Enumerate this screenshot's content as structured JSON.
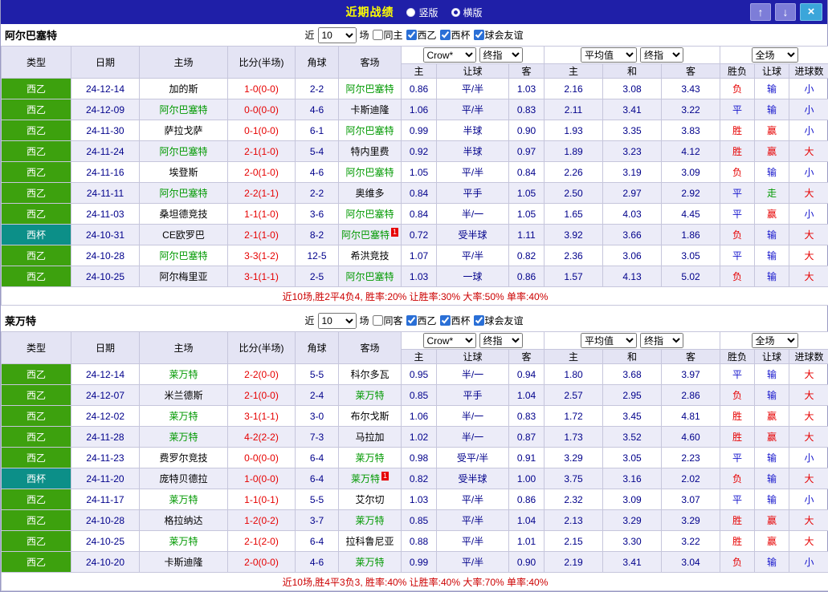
{
  "topbar": {
    "title": "近期战绩",
    "vertical_label": "竖版",
    "horizontal_label": "横版",
    "vertical_selected": false,
    "horizontal_selected": true,
    "up_icon": "↑",
    "down_icon": "↓",
    "close_icon": "×"
  },
  "filters": {
    "near_label": "近",
    "count": "10",
    "games_label": "场",
    "league_label": "西乙",
    "cup_label": "西杯",
    "friendly_label": "球会友谊",
    "same_venue_checked": false,
    "league_checked": true,
    "cup_checked": true,
    "friendly_checked": true
  },
  "table": {
    "headers": {
      "type": "类型",
      "date": "日期",
      "home": "主场",
      "score": "比分(半场)",
      "corner": "角球",
      "away": "客场",
      "home_odds": "主",
      "handicap": "让球",
      "away_odds": "客",
      "avg_home": "主",
      "avg_draw": "和",
      "avg_away": "客",
      "result": "胜负",
      "handicap_result": "让球",
      "goals": "进球数"
    },
    "dropdowns": {
      "bookmaker": "Crow*",
      "final": "终指",
      "average": "平均值",
      "final2": "终指",
      "fulltime": "全场"
    }
  },
  "outcome_colors": {
    "胜": "#e60000",
    "平": "#1414cc",
    "负": "#e60000",
    "赢": "#e60000",
    "输": "#1414cc",
    "走": "#009900",
    "大": "#e60000",
    "小": "#1414cc"
  },
  "colors": {
    "topbar_bg": "#1f1fa8",
    "title_color": "#ffff00",
    "league_badge": "#3da10e",
    "cup_badge": "#0c8f88",
    "subject_team": "#009900",
    "score_color": "#e60000",
    "odds_text": "#00008b",
    "summary_color": "#cc0000",
    "row_alt": "#ececf8",
    "header_bg": "#e4e4f4",
    "border_color": "#c6c6dc"
  },
  "sections": [
    {
      "team": "阿尔巴塞特",
      "same_label": "同主",
      "summary": "近10场,胜2平4负4, 胜率:20% 让胜率:30% 大率:50% 单率:40%",
      "rows": [
        {
          "comp": "西乙",
          "cup": false,
          "date": "24-12-14",
          "home": "加的斯",
          "home_subject": false,
          "home_card": "",
          "score": "1-0(0-0)",
          "corner": "2-2",
          "away": "阿尔巴塞特",
          "away_subject": true,
          "away_card": "",
          "odds": [
            "0.86",
            "平/半",
            "1.03"
          ],
          "avg": [
            "2.16",
            "3.08",
            "3.43"
          ],
          "outcome": [
            "负",
            "输",
            "小"
          ]
        },
        {
          "comp": "西乙",
          "cup": false,
          "date": "24-12-09",
          "home": "阿尔巴塞特",
          "home_subject": true,
          "home_card": "",
          "score": "0-0(0-0)",
          "corner": "4-6",
          "away": "卡斯迪隆",
          "away_subject": false,
          "away_card": "",
          "odds": [
            "1.06",
            "平/半",
            "0.83"
          ],
          "avg": [
            "2.11",
            "3.41",
            "3.22"
          ],
          "outcome": [
            "平",
            "输",
            "小"
          ]
        },
        {
          "comp": "西乙",
          "cup": false,
          "date": "24-11-30",
          "home": "萨拉戈萨",
          "home_subject": false,
          "home_card": "",
          "score": "0-1(0-0)",
          "corner": "6-1",
          "away": "阿尔巴塞特",
          "away_subject": true,
          "away_card": "",
          "odds": [
            "0.99",
            "半球",
            "0.90"
          ],
          "avg": [
            "1.93",
            "3.35",
            "3.83"
          ],
          "outcome": [
            "胜",
            "赢",
            "小"
          ]
        },
        {
          "comp": "西乙",
          "cup": false,
          "date": "24-11-24",
          "home": "阿尔巴塞特",
          "home_subject": true,
          "home_card": "",
          "score": "2-1(1-0)",
          "corner": "5-4",
          "away": "特内里费",
          "away_subject": false,
          "away_card": "",
          "odds": [
            "0.92",
            "半球",
            "0.97"
          ],
          "avg": [
            "1.89",
            "3.23",
            "4.12"
          ],
          "outcome": [
            "胜",
            "赢",
            "大"
          ]
        },
        {
          "comp": "西乙",
          "cup": false,
          "date": "24-11-16",
          "home": "埃登斯",
          "home_subject": false,
          "home_card": "",
          "score": "2-0(1-0)",
          "corner": "4-6",
          "away": "阿尔巴塞特",
          "away_subject": true,
          "away_card": "",
          "odds": [
            "1.05",
            "平/半",
            "0.84"
          ],
          "avg": [
            "2.26",
            "3.19",
            "3.09"
          ],
          "outcome": [
            "负",
            "输",
            "小"
          ]
        },
        {
          "comp": "西乙",
          "cup": false,
          "date": "24-11-11",
          "home": "阿尔巴塞特",
          "home_subject": true,
          "home_card": "",
          "score": "2-2(1-1)",
          "corner": "2-2",
          "away": "奥维多",
          "away_subject": false,
          "away_card": "",
          "odds": [
            "0.84",
            "平手",
            "1.05"
          ],
          "avg": [
            "2.50",
            "2.97",
            "2.92"
          ],
          "outcome": [
            "平",
            "走",
            "大"
          ]
        },
        {
          "comp": "西乙",
          "cup": false,
          "date": "24-11-03",
          "home": "桑坦德竞技",
          "home_subject": false,
          "home_card": "",
          "score": "1-1(1-0)",
          "corner": "3-6",
          "away": "阿尔巴塞特",
          "away_subject": true,
          "away_card": "",
          "odds": [
            "0.84",
            "半/一",
            "1.05"
          ],
          "avg": [
            "1.65",
            "4.03",
            "4.45"
          ],
          "outcome": [
            "平",
            "赢",
            "小"
          ]
        },
        {
          "comp": "西杯",
          "cup": true,
          "date": "24-10-31",
          "home": "CE欧罗巴",
          "home_subject": false,
          "home_card": "",
          "score": "2-1(1-0)",
          "corner": "8-2",
          "away": "阿尔巴塞特",
          "away_subject": true,
          "away_card": "1",
          "odds": [
            "0.72",
            "受半球",
            "1.11"
          ],
          "avg": [
            "3.92",
            "3.66",
            "1.86"
          ],
          "outcome": [
            "负",
            "输",
            "大"
          ]
        },
        {
          "comp": "西乙",
          "cup": false,
          "date": "24-10-28",
          "home": "阿尔巴塞特",
          "home_subject": true,
          "home_card": "",
          "score": "3-3(1-2)",
          "corner": "12-5",
          "away": "希洪竞技",
          "away_subject": false,
          "away_card": "",
          "odds": [
            "1.07",
            "平/半",
            "0.82"
          ],
          "avg": [
            "2.36",
            "3.06",
            "3.05"
          ],
          "outcome": [
            "平",
            "输",
            "大"
          ]
        },
        {
          "comp": "西乙",
          "cup": false,
          "date": "24-10-25",
          "home": "阿尔梅里亚",
          "home_subject": false,
          "home_card": "",
          "score": "3-1(1-1)",
          "corner": "2-5",
          "away": "阿尔巴塞特",
          "away_subject": true,
          "away_card": "",
          "odds": [
            "1.03",
            "一球",
            "0.86"
          ],
          "avg": [
            "1.57",
            "4.13",
            "5.02"
          ],
          "outcome": [
            "负",
            "输",
            "大"
          ]
        }
      ]
    },
    {
      "team": "莱万特",
      "same_label": "同客",
      "summary": "近10场,胜4平3负3, 胜率:40% 让胜率:40% 大率:70% 单率:40%",
      "rows": [
        {
          "comp": "西乙",
          "cup": false,
          "date": "24-12-14",
          "home": "莱万特",
          "home_subject": true,
          "home_card": "",
          "score": "2-2(0-0)",
          "corner": "5-5",
          "away": "科尔多瓦",
          "away_subject": false,
          "away_card": "",
          "odds": [
            "0.95",
            "半/一",
            "0.94"
          ],
          "avg": [
            "1.80",
            "3.68",
            "3.97"
          ],
          "outcome": [
            "平",
            "输",
            "大"
          ]
        },
        {
          "comp": "西乙",
          "cup": false,
          "date": "24-12-07",
          "home": "米兰德斯",
          "home_subject": false,
          "home_card": "",
          "score": "2-1(0-0)",
          "corner": "2-4",
          "away": "莱万特",
          "away_subject": true,
          "away_card": "",
          "odds": [
            "0.85",
            "平手",
            "1.04"
          ],
          "avg": [
            "2.57",
            "2.95",
            "2.86"
          ],
          "outcome": [
            "负",
            "输",
            "大"
          ]
        },
        {
          "comp": "西乙",
          "cup": false,
          "date": "24-12-02",
          "home": "莱万特",
          "home_subject": true,
          "home_card": "",
          "score": "3-1(1-1)",
          "corner": "3-0",
          "away": "布尔戈斯",
          "away_subject": false,
          "away_card": "",
          "odds": [
            "1.06",
            "半/一",
            "0.83"
          ],
          "avg": [
            "1.72",
            "3.45",
            "4.81"
          ],
          "outcome": [
            "胜",
            "赢",
            "大"
          ]
        },
        {
          "comp": "西乙",
          "cup": false,
          "date": "24-11-28",
          "home": "莱万特",
          "home_subject": true,
          "home_card": "",
          "score": "4-2(2-2)",
          "corner": "7-3",
          "away": "马拉加",
          "away_subject": false,
          "away_card": "",
          "odds": [
            "1.02",
            "半/一",
            "0.87"
          ],
          "avg": [
            "1.73",
            "3.52",
            "4.60"
          ],
          "outcome": [
            "胜",
            "赢",
            "大"
          ]
        },
        {
          "comp": "西乙",
          "cup": false,
          "date": "24-11-23",
          "home": "费罗尔竞技",
          "home_subject": false,
          "home_card": "",
          "score": "0-0(0-0)",
          "corner": "6-4",
          "away": "莱万特",
          "away_subject": true,
          "away_card": "",
          "odds": [
            "0.98",
            "受平/半",
            "0.91"
          ],
          "avg": [
            "3.29",
            "3.05",
            "2.23"
          ],
          "outcome": [
            "平",
            "输",
            "小"
          ]
        },
        {
          "comp": "西杯",
          "cup": true,
          "date": "24-11-20",
          "home": "庞特贝德拉",
          "home_subject": false,
          "home_card": "",
          "score": "1-0(0-0)",
          "corner": "6-4",
          "away": "莱万特",
          "away_subject": true,
          "away_card": "1",
          "odds": [
            "0.82",
            "受半球",
            "1.00"
          ],
          "avg": [
            "3.75",
            "3.16",
            "2.02"
          ],
          "outcome": [
            "负",
            "输",
            "大"
          ]
        },
        {
          "comp": "西乙",
          "cup": false,
          "date": "24-11-17",
          "home": "莱万特",
          "home_subject": true,
          "home_card": "",
          "score": "1-1(0-1)",
          "corner": "5-5",
          "away": "艾尔切",
          "away_subject": false,
          "away_card": "",
          "odds": [
            "1.03",
            "平/半",
            "0.86"
          ],
          "avg": [
            "2.32",
            "3.09",
            "3.07"
          ],
          "outcome": [
            "平",
            "输",
            "小"
          ]
        },
        {
          "comp": "西乙",
          "cup": false,
          "date": "24-10-28",
          "home": "格拉纳达",
          "home_subject": false,
          "home_card": "",
          "score": "1-2(0-2)",
          "corner": "3-7",
          "away": "莱万特",
          "away_subject": true,
          "away_card": "",
          "odds": [
            "0.85",
            "平/半",
            "1.04"
          ],
          "avg": [
            "2.13",
            "3.29",
            "3.29"
          ],
          "outcome": [
            "胜",
            "赢",
            "大"
          ]
        },
        {
          "comp": "西乙",
          "cup": false,
          "date": "24-10-25",
          "home": "莱万特",
          "home_subject": true,
          "home_card": "",
          "score": "2-1(2-0)",
          "corner": "6-4",
          "away": "拉科鲁尼亚",
          "away_subject": false,
          "away_card": "",
          "odds": [
            "0.88",
            "平/半",
            "1.01"
          ],
          "avg": [
            "2.15",
            "3.30",
            "3.22"
          ],
          "outcome": [
            "胜",
            "赢",
            "大"
          ]
        },
        {
          "comp": "西乙",
          "cup": false,
          "date": "24-10-20",
          "home": "卡斯迪隆",
          "home_subject": false,
          "home_card": "",
          "score": "2-0(0-0)",
          "corner": "4-6",
          "away": "莱万特",
          "away_subject": true,
          "away_card": "",
          "odds": [
            "0.99",
            "平/半",
            "0.90"
          ],
          "avg": [
            "2.19",
            "3.41",
            "3.04"
          ],
          "outcome": [
            "负",
            "输",
            "小"
          ]
        }
      ]
    }
  ]
}
